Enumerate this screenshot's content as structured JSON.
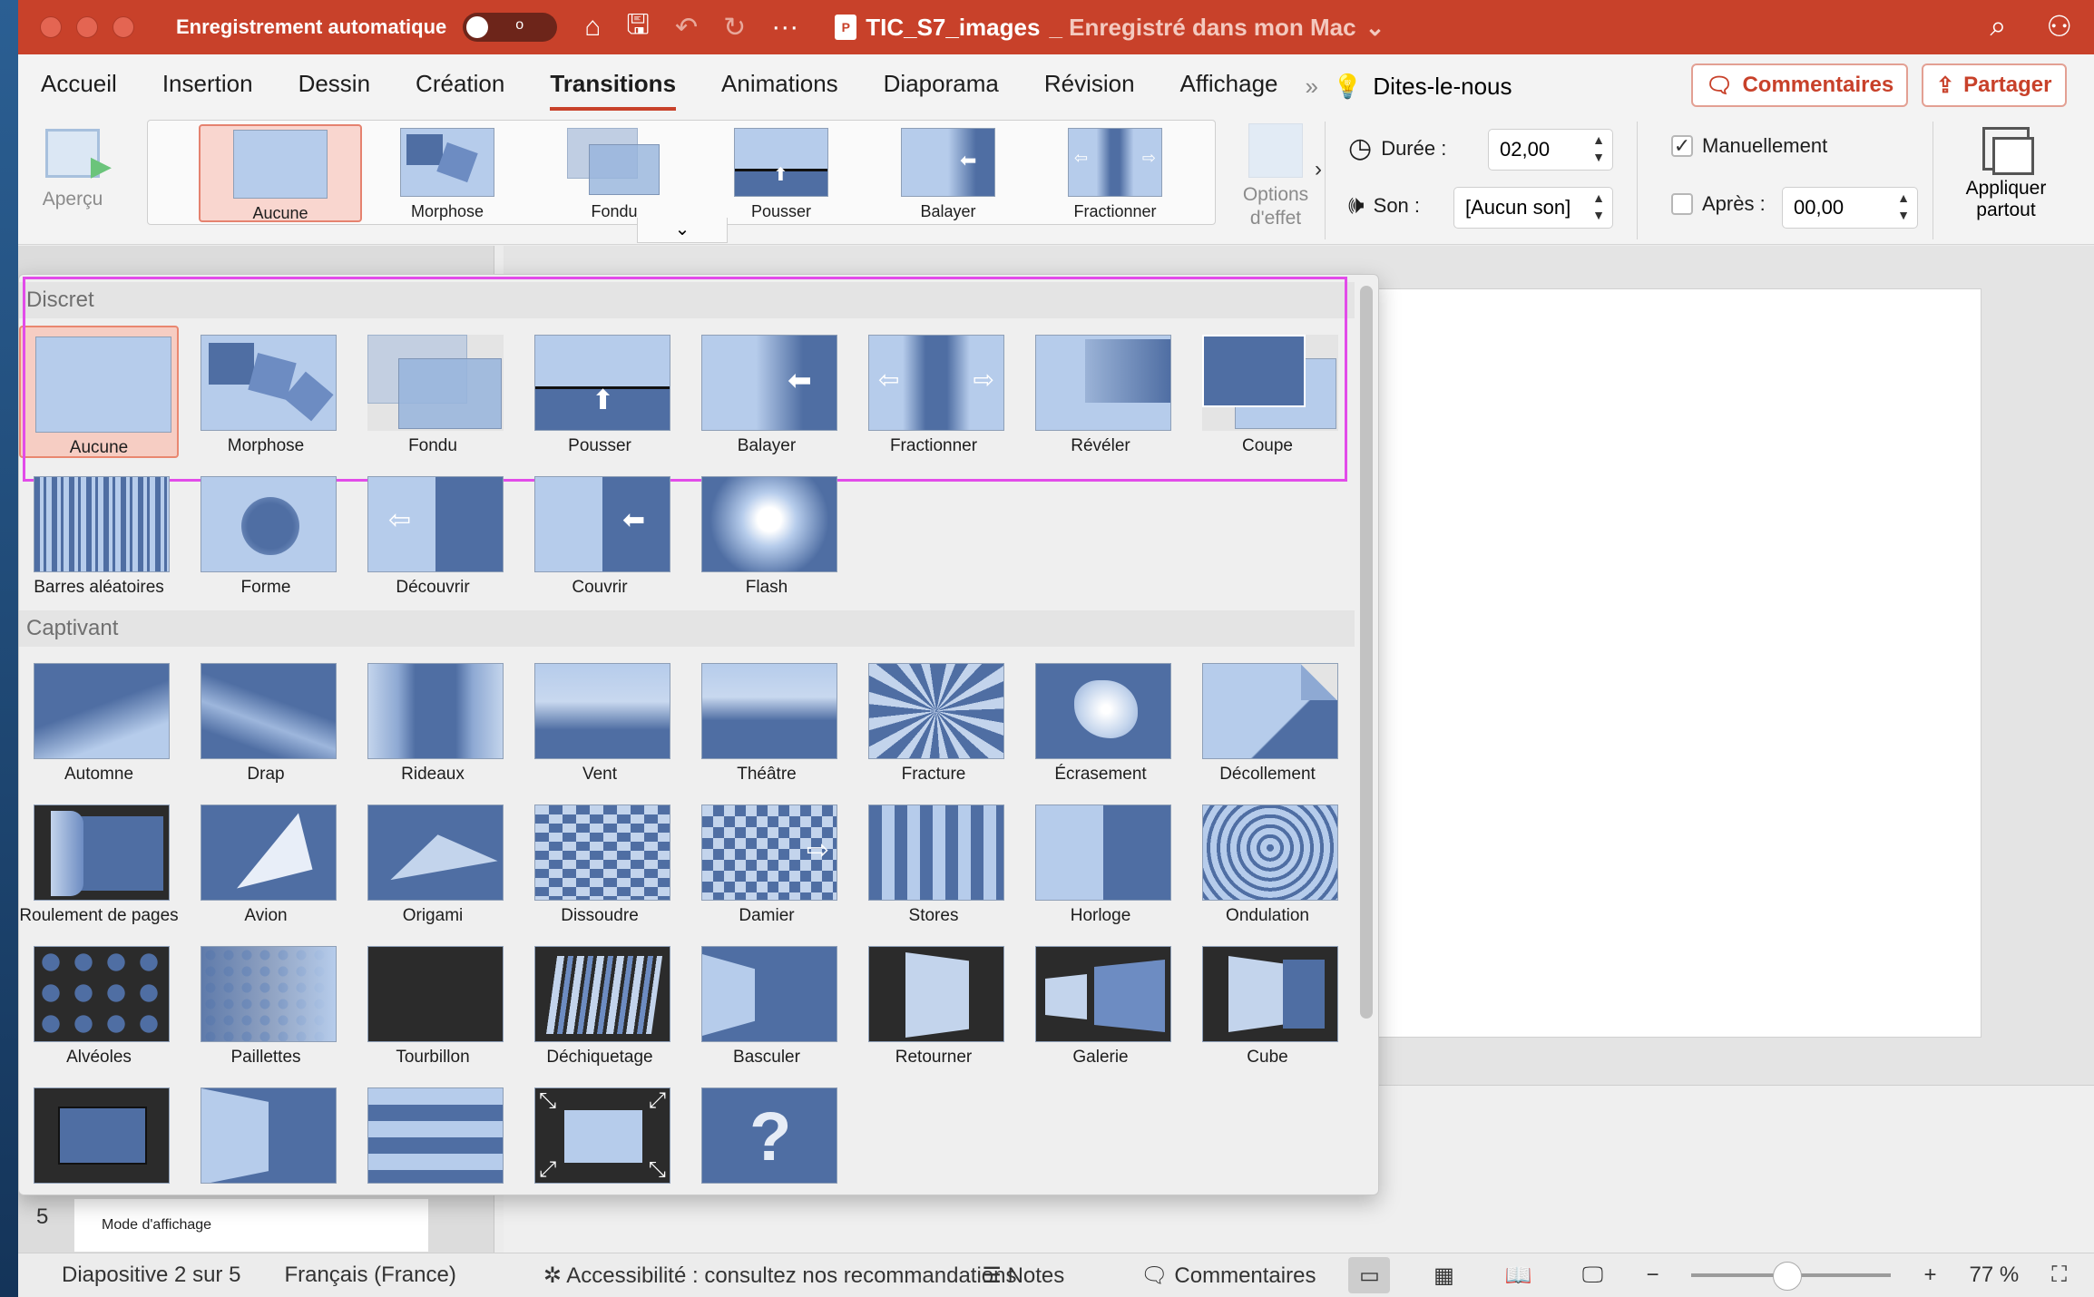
{
  "titlebar": {
    "autosave_label": "Enregistrement automatique",
    "autosave_state": "o",
    "doc_name": "TIC_S7_images",
    "doc_status": "_ Enregistré dans mon Mac",
    "icons": [
      "home-icon",
      "save-icon",
      "undo-icon",
      "redo-icon",
      "more-icon",
      "search-icon",
      "share-people-icon"
    ]
  },
  "menu": {
    "tabs": [
      "Accueil",
      "Insertion",
      "Dessin",
      "Création",
      "Transitions",
      "Animations",
      "Diaporama",
      "Révision",
      "Affichage"
    ],
    "active": "Transitions",
    "tell_me": "Dites-le-nous",
    "comments_btn": "Commentaires",
    "share_btn": "Partager"
  },
  "ribbon": {
    "preview_label": "Aperçu",
    "gallery": [
      "Aucune",
      "Morphose",
      "Fondu",
      "Pousser",
      "Balayer",
      "Fractionner"
    ],
    "effect_options_line1": "Options",
    "effect_options_line2": "d'effet",
    "duration_label": "Durée :",
    "duration_value": "02,00",
    "sound_label": "Son :",
    "sound_value": "[Aucun son]",
    "manual_label": "Manuellement",
    "manual_checked": true,
    "after_label": "Après :",
    "after_value": "00,00",
    "after_checked": false,
    "apply_all_line1": "Appliquer",
    "apply_all_line2": "partout"
  },
  "dropdown": {
    "section_discret": "Discret",
    "section_captivant": "Captivant",
    "discret_row1": [
      "Aucune",
      "Morphose",
      "Fondu",
      "Pousser",
      "Balayer",
      "Fractionner",
      "Révéler",
      "Coupe"
    ],
    "discret_row2": [
      "Barres aléatoires",
      "Forme",
      "Découvrir",
      "Couvrir",
      "Flash"
    ],
    "captivant_row1": [
      "Automne",
      "Drap",
      "Rideaux",
      "Vent",
      "Théâtre",
      "Fracture",
      "Écrasement",
      "Décollement"
    ],
    "captivant_row2": [
      "Roulement de pages",
      "Avion",
      "Origami",
      "Dissoudre",
      "Damier",
      "Stores",
      "Horloge",
      "Ondulation"
    ],
    "captivant_row3": [
      "Alvéoles",
      "Paillettes",
      "Tourbillon",
      "Déchiquetage",
      "Basculer",
      "Retourner",
      "Galerie",
      "Cube"
    ]
  },
  "slides": {
    "visible_number": "5",
    "visible_title": "Mode d'affichage"
  },
  "statusbar": {
    "slide_info": "Diapositive 2 sur 5",
    "language": "Français (France)",
    "accessibility": "Accessibilité : consultez nos recommandations",
    "notes": "Notes",
    "comments": "Commentaires",
    "zoom": "77 %"
  },
  "colors": {
    "accent": "#c8412a",
    "selection_fill": "#f6cdc3",
    "highlight_border": "#e24ce9",
    "thumb_blue": "#b6cceb"
  }
}
